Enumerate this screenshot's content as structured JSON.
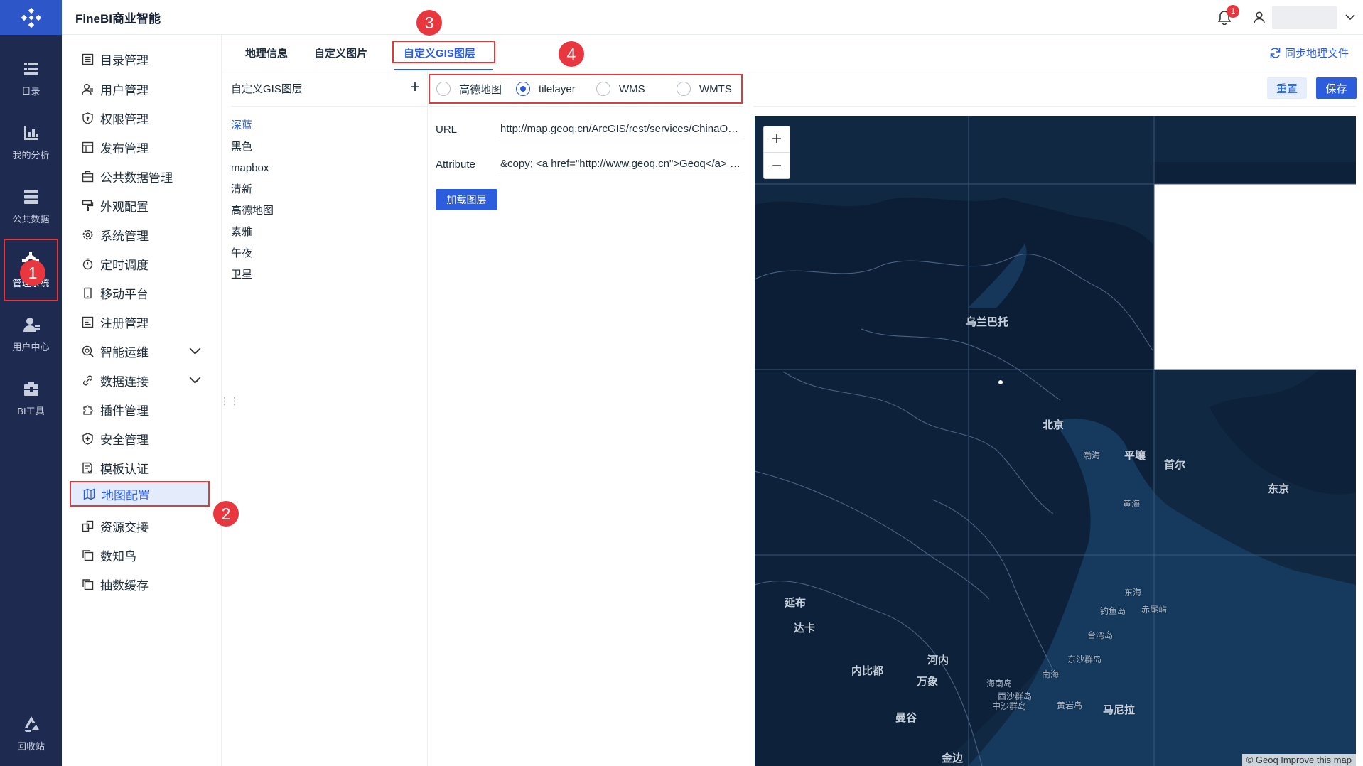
{
  "header": {
    "title": "FineBI商业智能",
    "notification_count": "1"
  },
  "rail": {
    "items": [
      {
        "label": "目录",
        "icon": "catalog-icon"
      },
      {
        "label": "我的分析",
        "icon": "analysis-icon"
      },
      {
        "label": "公共数据",
        "icon": "public-data-icon"
      },
      {
        "label": "管理系统",
        "icon": "gear-icon"
      },
      {
        "label": "用户中心",
        "icon": "user-center-icon"
      },
      {
        "label": "BI工具",
        "icon": "toolbox-icon"
      },
      {
        "label": "回收站",
        "icon": "recycle-bin-icon"
      }
    ]
  },
  "menu": {
    "items": [
      {
        "label": "目录管理"
      },
      {
        "label": "用户管理"
      },
      {
        "label": "权限管理"
      },
      {
        "label": "发布管理"
      },
      {
        "label": "公共数据管理"
      },
      {
        "label": "外观配置"
      },
      {
        "label": "系统管理"
      },
      {
        "label": "定时调度"
      },
      {
        "label": "移动平台"
      },
      {
        "label": "注册管理"
      },
      {
        "label": "智能运维"
      },
      {
        "label": "数据连接"
      },
      {
        "label": "插件管理"
      },
      {
        "label": "安全管理"
      },
      {
        "label": "模板认证"
      },
      {
        "label": "地图配置"
      },
      {
        "label": "资源交接"
      },
      {
        "label": "数知鸟"
      },
      {
        "label": "抽数缓存"
      }
    ]
  },
  "tabs": [
    {
      "label": "地理信息"
    },
    {
      "label": "自定义图片"
    },
    {
      "label": "自定义GIS图层"
    }
  ],
  "sync_label": "同步地理文件",
  "layer_list": {
    "title": "自定义GIS图层",
    "items": [
      "深蓝",
      "黑色",
      "mapbox",
      "清新",
      "高德地图",
      "素雅",
      "午夜",
      "卫星"
    ],
    "selected": "深蓝"
  },
  "layer_type": {
    "options": [
      "高德地图",
      "tilelayer",
      "WMS",
      "WMTS"
    ],
    "selected": "tilelayer"
  },
  "form": {
    "url_label": "URL",
    "url_value": "http://map.geoq.cn/ArcGIS/rest/services/ChinaOnlineStreetPurplishBlue/MapServer/tile/{z}/{y}/{x}",
    "attribution_label": "Attribute",
    "attribution_value": "&copy; <a href=\"http://www.geoq.cn\">Geoq</a> contributors",
    "load_button": "加载图层"
  },
  "actions": {
    "reset": "重置",
    "save": "保存"
  },
  "map": {
    "attribution": "© Geoq Improve this map",
    "labels": [
      "乌兰巴托",
      "北京",
      "渤海",
      "平壤",
      "首尔",
      "东京",
      "黄海",
      "东海",
      "钓鱼岛",
      "赤尾屿",
      "台湾岛",
      "延布",
      "达卡",
      "内比都",
      "河内",
      "万象",
      "南海",
      "海南岛",
      "东沙群岛",
      "西沙群岛",
      "中沙群岛",
      "黄岩岛",
      "马尼拉",
      "曼谷",
      "金边"
    ]
  },
  "callouts": [
    "1",
    "2",
    "3",
    "4"
  ],
  "colors": {
    "accent": "#2c5ddc",
    "rail_bg": "#1e2a4f",
    "highlight": "#e03a3a",
    "map_bg": "#0f2540"
  }
}
